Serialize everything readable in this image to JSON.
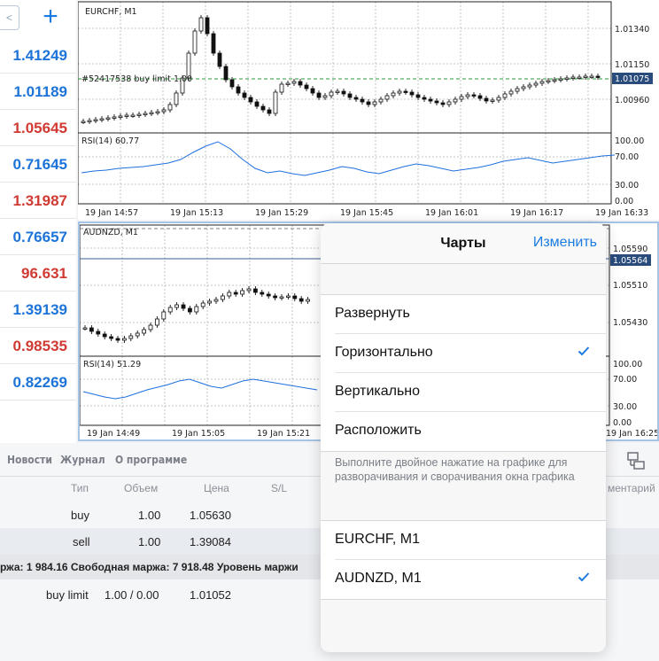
{
  "nav": {
    "back_label": "<",
    "add_label": "+"
  },
  "quotes": [
    {
      "value": "1.41249",
      "color": "blue"
    },
    {
      "value": "1.01189",
      "color": "blue"
    },
    {
      "value": "1.05645",
      "color": "red"
    },
    {
      "value": "0.71645",
      "color": "blue"
    },
    {
      "value": "1.31987",
      "color": "red"
    },
    {
      "value": "0.76657",
      "color": "blue"
    },
    {
      "value": "96.631",
      "color": "red"
    },
    {
      "value": "1.39139",
      "color": "blue"
    },
    {
      "value": "0.98535",
      "color": "red"
    },
    {
      "value": "0.82269",
      "color": "blue"
    }
  ],
  "chart1": {
    "title": "EURCHF, M1",
    "order_label": "#52417538 buy limit 1.00",
    "price_ticks": [
      "1.01340",
      "1.01150",
      "1.00960"
    ],
    "current_price": "1.01075",
    "rsi_label": "RSI(14) 60.77",
    "rsi_ticks": [
      "100.00",
      "70.00",
      "30.00",
      "0.00"
    ],
    "time_ticks": [
      "19 Jan 14:57",
      "19 Jan 15:13",
      "19 Jan 15:29",
      "19 Jan 15:45",
      "19 Jan 16:01",
      "19 Jan 16:17",
      "19 Jan 16:33"
    ]
  },
  "chart2": {
    "title": "AUDNZD, M1",
    "price_ticks": [
      "1.05590",
      "1.05510",
      "1.05430"
    ],
    "current_price": "1.05564",
    "rsi_label": "RSI(14) 51.29",
    "rsi_ticks": [
      "100.00",
      "70.00",
      "30.00",
      "0.00"
    ],
    "time_ticks": [
      "19 Jan 14:49",
      "19 Jan 15:05",
      "19 Jan 15:21",
      "19 Jan 16:25"
    ]
  },
  "bottom": {
    "tabs": [
      "Новости",
      "Журнал",
      "О программе"
    ],
    "headers": [
      "Тип",
      "Объем",
      "Цена",
      "S/L",
      "ментарий"
    ],
    "rows": [
      {
        "type": "buy",
        "volume": "1.00",
        "price": "1.05630"
      },
      {
        "type": "sell",
        "volume": "1.00",
        "price": "1.39084"
      }
    ],
    "margin_text": "ржа: 1 984.16 Свободная маржа: 7 918.48 Уровень маржи",
    "pending": {
      "type": "buy limit",
      "volume": "1.00 / 0.00",
      "price": "1.01052"
    }
  },
  "popover": {
    "title": "Чарты",
    "edit_label": "Изменить",
    "layout_items": [
      {
        "label": "Развернуть",
        "checked": false
      },
      {
        "label": "Горизонтально",
        "checked": true
      },
      {
        "label": "Вертикально",
        "checked": false
      },
      {
        "label": "Расположить",
        "checked": false
      }
    ],
    "hint": "Выполните двойное нажатие на графике для разворачивания и сворачивания окна графика",
    "chart_items": [
      {
        "label": "EURCHF, M1",
        "checked": false
      },
      {
        "label": "AUDNZD, M1",
        "checked": true
      }
    ]
  },
  "colors": {
    "accent": "#1a7be0",
    "bid_blue": "#1c73d8",
    "ask_red": "#d03a32",
    "rsi_line": "#1f6fe0",
    "price_tag_bg": "#2a4c7c"
  }
}
